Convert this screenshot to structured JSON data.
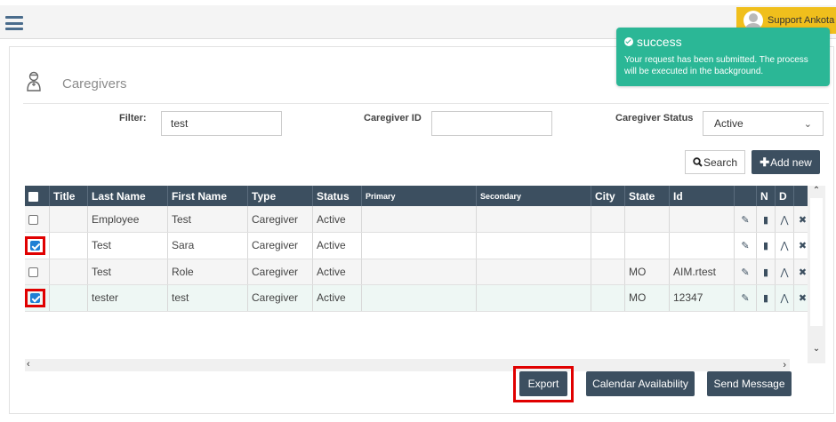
{
  "header": {
    "support_label": "Support Ankota"
  },
  "page": {
    "title": "Caregivers"
  },
  "filters": {
    "filter_label": "Filter:",
    "filter_value": "test",
    "caregiver_id_label": "Caregiver ID",
    "caregiver_id_value": "",
    "status_label": "Caregiver Status",
    "status_value": "Active"
  },
  "buttons": {
    "search": "Search",
    "add_new": "Add new",
    "export": "Export",
    "calendar": "Calendar Availability",
    "send_message": "Send Message"
  },
  "table": {
    "headers": {
      "title": "Title",
      "last_name": "Last Name",
      "first_name": "First Name",
      "type": "Type",
      "status": "Status",
      "primary": "Primary",
      "secondary": "Secondary",
      "city": "City",
      "state": "State",
      "id": "Id",
      "n": "N",
      "d": "D"
    },
    "rows": [
      {
        "checked": false,
        "title": "",
        "last_name": "Employee",
        "first_name": "Test",
        "type": "Caregiver",
        "status": "Active",
        "primary": "",
        "secondary": "",
        "city": "",
        "state": "",
        "id": ""
      },
      {
        "checked": true,
        "title": "",
        "last_name": "Test",
        "first_name": "Sara",
        "type": "Caregiver",
        "status": "Active",
        "primary": "",
        "secondary": "",
        "city": "",
        "state": "",
        "id": ""
      },
      {
        "checked": false,
        "title": "",
        "last_name": "Test",
        "first_name": "Role",
        "type": "Caregiver",
        "status": "Active",
        "primary": "",
        "secondary": "",
        "city": "",
        "state": "MO",
        "id": "AIM.rtest"
      },
      {
        "checked": true,
        "title": "",
        "last_name": "tester",
        "first_name": "test",
        "type": "Caregiver",
        "status": "Active",
        "primary": "",
        "secondary": "",
        "city": "",
        "state": "MO",
        "id": "12347"
      }
    ]
  },
  "toast": {
    "title": "success",
    "message": "Your request has been submitted. The process will be executed in the background."
  },
  "colors": {
    "header_bg": "#3c4f60",
    "toast_bg": "#2bb796",
    "support_bg": "#f0bf1c",
    "highlight_red": "#e00000"
  }
}
